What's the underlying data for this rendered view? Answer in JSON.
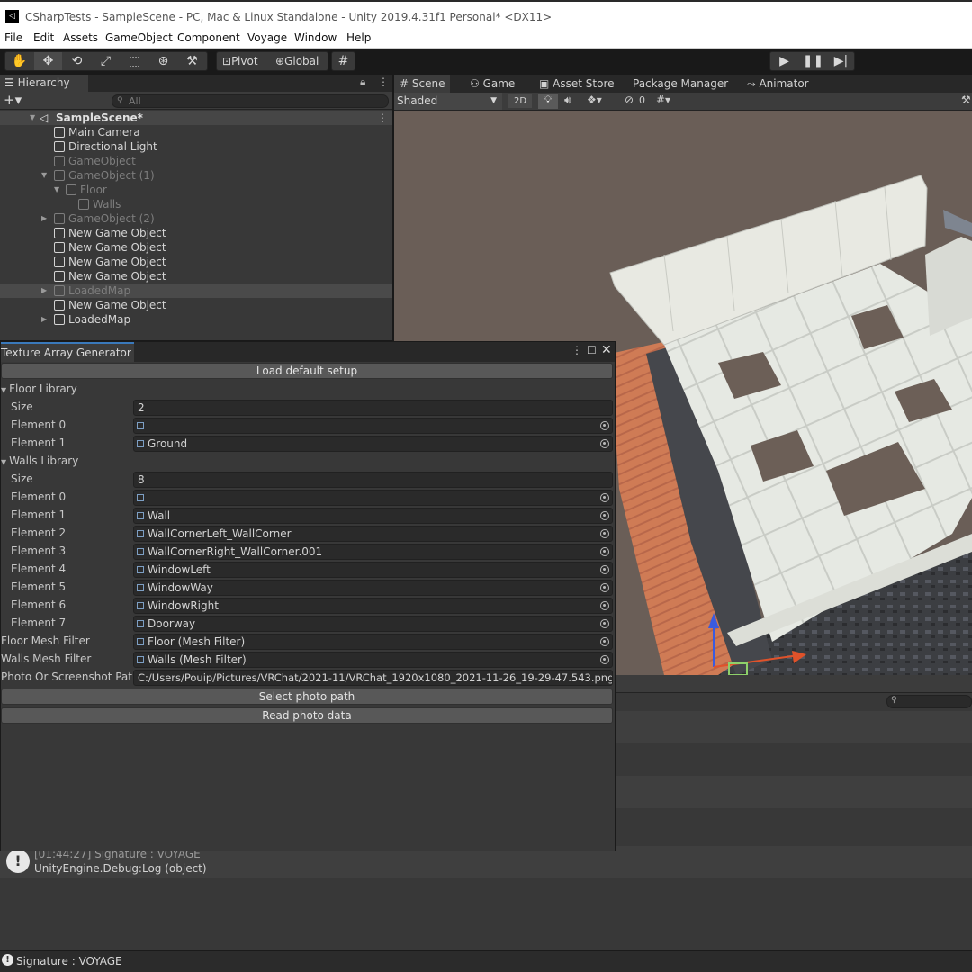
{
  "window": {
    "title": "CSharpTests - SampleScene - PC, Mac & Linux Standalone - Unity 2019.4.31f1 Personal* <DX11>"
  },
  "menu": [
    "File",
    "Edit",
    "Assets",
    "GameObject",
    "Component",
    "Voyage",
    "Window",
    "Help"
  ],
  "toolbar": {
    "pivot_label": "Pivot",
    "global_label": "Global"
  },
  "hierarchy": {
    "tab_label": "Hierarchy",
    "search_placeholder": "All",
    "scene_name": "SampleScene*",
    "items": [
      {
        "label": "Main Camera"
      },
      {
        "label": "Directional Light"
      },
      {
        "label": "GameObject"
      },
      {
        "label": "GameObject (1)"
      },
      {
        "label": "Floor"
      },
      {
        "label": "Walls"
      },
      {
        "label": "GameObject (2)"
      },
      {
        "label": "New Game Object"
      },
      {
        "label": "New Game Object"
      },
      {
        "label": "New Game Object"
      },
      {
        "label": "New Game Object"
      },
      {
        "label": "LoadedMap"
      },
      {
        "label": "New Game Object"
      },
      {
        "label": "LoadedMap"
      }
    ]
  },
  "scene": {
    "tabs": [
      "Scene",
      "Game",
      "Asset Store",
      "Package Manager",
      "Animator"
    ],
    "shading_mode": "Shaded",
    "mode_2d": "2D",
    "hidden_count": "0"
  },
  "tag_window": {
    "title": "Texture Array Generator",
    "load_default_label": "Load default setup",
    "floor_library": {
      "label": "Floor Library",
      "size_label": "Size",
      "size": "2",
      "elements": [
        {
          "label": "Element 0",
          "value": ""
        },
        {
          "label": "Element 1",
          "value": "Ground"
        }
      ]
    },
    "walls_library": {
      "label": "Walls Library",
      "size_label": "Size",
      "size": "8",
      "elements": [
        {
          "label": "Element 0",
          "value": ""
        },
        {
          "label": "Element 1",
          "value": "Wall"
        },
        {
          "label": "Element 2",
          "value": "WallCornerLeft_WallCorner"
        },
        {
          "label": "Element 3",
          "value": "WallCornerRight_WallCorner.001"
        },
        {
          "label": "Element 4",
          "value": "WindowLeft"
        },
        {
          "label": "Element 5",
          "value": "WindowWay"
        },
        {
          "label": "Element 6",
          "value": "WindowRight"
        },
        {
          "label": "Element 7",
          "value": "Doorway"
        }
      ]
    },
    "floor_mesh_filter": {
      "label": "Floor Mesh Filter",
      "value": "Floor (Mesh Filter)"
    },
    "walls_mesh_filter": {
      "label": "Walls Mesh Filter",
      "value": "Walls (Mesh Filter)"
    },
    "photo_path": {
      "label": "Photo Or Screenshot Path",
      "value": "C:/Users/Pouip/Pictures/VRChat/2021-11/VRChat_1920x1080_2021-11-26_19-29-47.543.png"
    },
    "select_photo_label": "Select photo path",
    "read_photo_label": "Read photo data"
  },
  "console": {
    "log_line1": "[01:44:27] Signature : VOYAGE",
    "log_line2": "UnityEngine.Debug:Log (object)"
  },
  "status": {
    "message": "Signature : VOYAGE"
  }
}
